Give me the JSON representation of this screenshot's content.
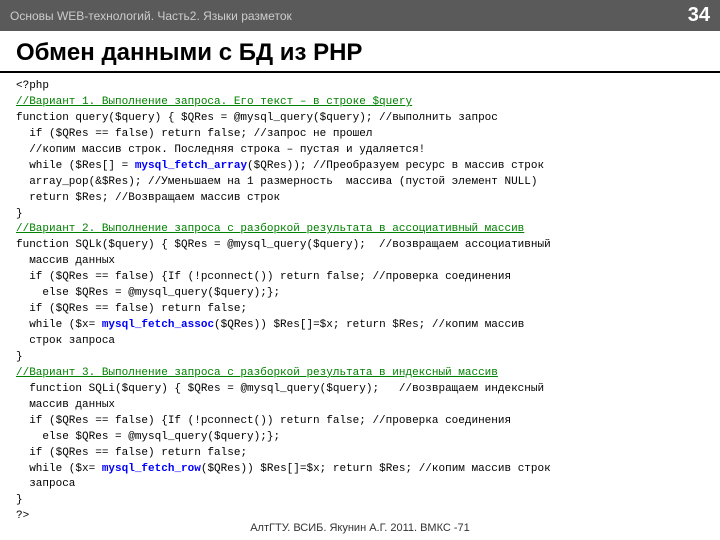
{
  "header": {
    "title": "Основы WEB-технологий. Часть2. Языки разметок",
    "slide_number": "34"
  },
  "slide": {
    "title": "Обмен данными с БД из PHP"
  },
  "footer": {
    "text": "АлтГТУ. ВСИБ. Якунин А.Г. 2011. ВМКС -71"
  }
}
